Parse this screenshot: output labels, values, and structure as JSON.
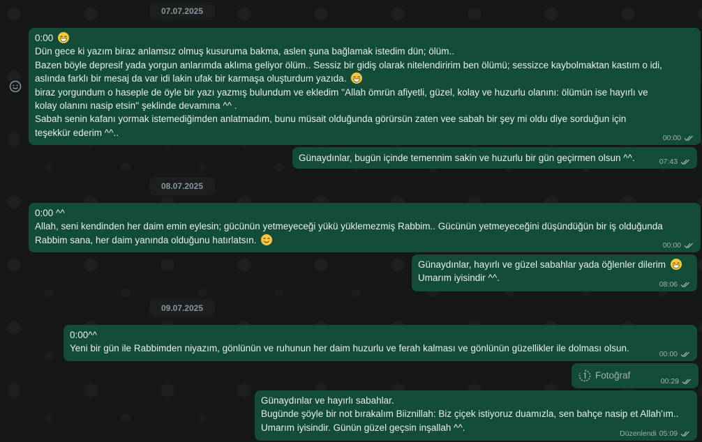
{
  "date_separators": [
    "07.07.2025",
    "08.07.2025",
    "09.07.2025"
  ],
  "messages": [
    {
      "direction": "incoming",
      "lines": [
        "0:00",
        "Dün gece ki yazım biraz anlamsız olmuş kusuruma bakma, aslen şuna bağlamak istedim dün; ölüm..",
        "Bazen böyle depresif yada yorgun anlarımda aklıma geliyor ölüm.. Sessiz bir gidiş olarak nitelendiririm ben ölümü; sessizce kaybolmaktan kastım o idi,",
        "aslında farklı bir mesaj da var idi lakin ufak bir karmaşa oluşturdum yazıda.",
        "biraz yorgundum o haseple de öyle bir yazı yazmış bulundum ve ekledim ''Allah ömrün afiyetli, güzel, kolay ve huzurlu olanını: ölümün ise hayırlı ve",
        "kolay olanını nasip etsin''  şeklinde devamına ^^ .",
        "Sabah senin kafanı yormak istemediğimden anlatmadım, bunu müsait olduğunda görürsün zaten vee sabah bir şey mi oldu diye sorduğun için",
        "teşekkür ederim ^^.."
      ],
      "time": "00:00"
    },
    {
      "direction": "outgoing",
      "lines": [
        "Günaydınlar, bugün içinde temennim sakin ve huzurlu bir gün geçirmen olsun ^^."
      ],
      "time": "07:43"
    },
    {
      "direction": "incoming",
      "lines": [
        "0:00 ^^",
        "Allah, seni kendinden her daim emin eylesin; gücünün yetmeyeceği yükü yüklemezmiş Rabbim.. Gücünün yetmeyeceğini düşündüğün bir iş olduğunda",
        "Rabbim sana, her daim yanında olduğunu hatırlatsın."
      ],
      "time": "00:00"
    },
    {
      "direction": "outgoing",
      "lines": [
        "Günaydınlar, hayırlı ve güzel sabahlar yada öğlenler dilerim",
        "Umarım iyisindir ^^."
      ],
      "time": "08:06"
    },
    {
      "direction": "incoming",
      "lines": [
        "0:00^^",
        "Yeni bir gün ile Rabbimden niyazım, gönlünün ve ruhunun her daim huzurlu ve ferah kalması ve gönlünün güzellikler ile dolması olsun."
      ],
      "time": "00:00"
    },
    {
      "direction": "outgoing",
      "type": "photo",
      "label": "Fotoğraf",
      "time": "00:29"
    },
    {
      "direction": "outgoing",
      "lines": [
        "Günaydınlar ve hayırlı sabahlar.",
        "Bugünde şöyle bir not bırakalım Biiznillah: Biz çiçek istiyoruz duamızla, sen bahçe nasip et Allah'ım..",
        "Umarım iyisindir. Günün güzel geçsin inşallah ^^."
      ],
      "edited_label": "Düzenlendi",
      "time": "05:09"
    }
  ],
  "colors": {
    "background": "#161717",
    "bubble": "#144d37",
    "meta_text": "#a3b1ab",
    "date_text": "#8696a0"
  },
  "icons": [
    "smiley-react-icon",
    "grin-emoji-icon",
    "sweat-smile-emoji-icon",
    "smiling-emoji-icon",
    "double-check-icon",
    "view-once-icon"
  ]
}
